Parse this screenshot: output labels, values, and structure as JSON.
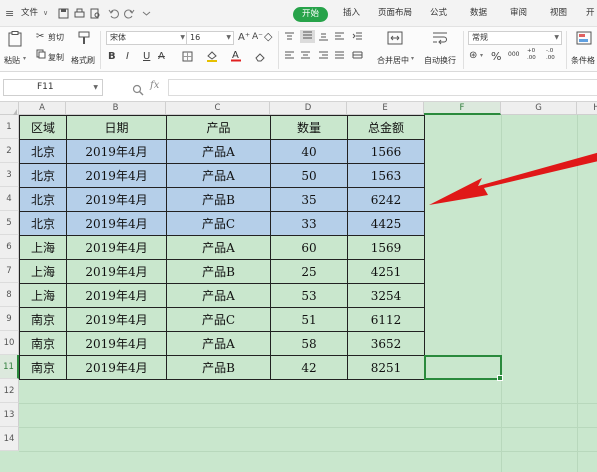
{
  "menubar": {
    "menu_icon": "≡",
    "file_label": "文件",
    "file_chevron": "∨",
    "quick_icons": [
      "save-icon",
      "print-icon",
      "print-preview-icon",
      "undo-icon",
      "redo-icon",
      "customize-icon"
    ],
    "tabs": [
      "开始",
      "插入",
      "页面布局",
      "公式",
      "数据",
      "审阅",
      "视图",
      "开发"
    ],
    "active_tab": "开始"
  },
  "ribbon": {
    "paste_label": "粘贴",
    "cut_label": "剪切",
    "copy_label": "复制",
    "format_painter_label": "格式刷",
    "font_name": "宋体",
    "font_size": "16",
    "grow_font": "A⁺",
    "shrink_font": "A⁻",
    "bold": "B",
    "italic": "I",
    "underline": "U",
    "strike": "A",
    "merge_label": "合并居中",
    "wrap_label": "自动换行",
    "number_format": "常规",
    "percent": "%",
    "thousands": "000",
    "dec_inc": "+0 .00",
    "dec_dec": "-.0 .00",
    "cond_format_label": "条件格"
  },
  "formula_bar": {
    "cell_ref": "F11",
    "zoom_icon": "zoom-icon",
    "fx": "fx",
    "content": ""
  },
  "sheet": {
    "columns": [
      "A",
      "B",
      "C",
      "D",
      "E",
      "F",
      "G",
      "H"
    ],
    "selected_column": "F",
    "rows": [
      "1",
      "2",
      "3",
      "4",
      "5",
      "6",
      "7",
      "8",
      "9",
      "10",
      "11",
      "12",
      "13",
      "14"
    ],
    "selected_row": "11",
    "selected_cell": "F11",
    "header": [
      "区域",
      "日期",
      "产品",
      "数量",
      "总金额"
    ],
    "data": [
      [
        "北京",
        "2019年4月",
        "产品A",
        "40",
        "1566"
      ],
      [
        "北京",
        "2019年4月",
        "产品A",
        "50",
        "1563"
      ],
      [
        "北京",
        "2019年4月",
        "产品B",
        "35",
        "6242"
      ],
      [
        "北京",
        "2019年4月",
        "产品C",
        "33",
        "4425"
      ],
      [
        "上海",
        "2019年4月",
        "产品A",
        "60",
        "1569"
      ],
      [
        "上海",
        "2019年4月",
        "产品B",
        "25",
        "4251"
      ],
      [
        "上海",
        "2019年4月",
        "产品A",
        "53",
        "3254"
      ],
      [
        "南京",
        "2019年4月",
        "产品C",
        "51",
        "6112"
      ],
      [
        "南京",
        "2019年4月",
        "产品A",
        "58",
        "3652"
      ],
      [
        "南京",
        "2019年4月",
        "产品B",
        "42",
        "8251"
      ]
    ],
    "highlighted_rows": [
      0,
      1,
      2,
      3
    ],
    "highlight_color": "#b5cfe9",
    "sheet_bg_color": "#c9e7cd",
    "accent_color": "#2a8a3c",
    "annotation": "red-arrow-pointing-to-beijing-rows"
  }
}
